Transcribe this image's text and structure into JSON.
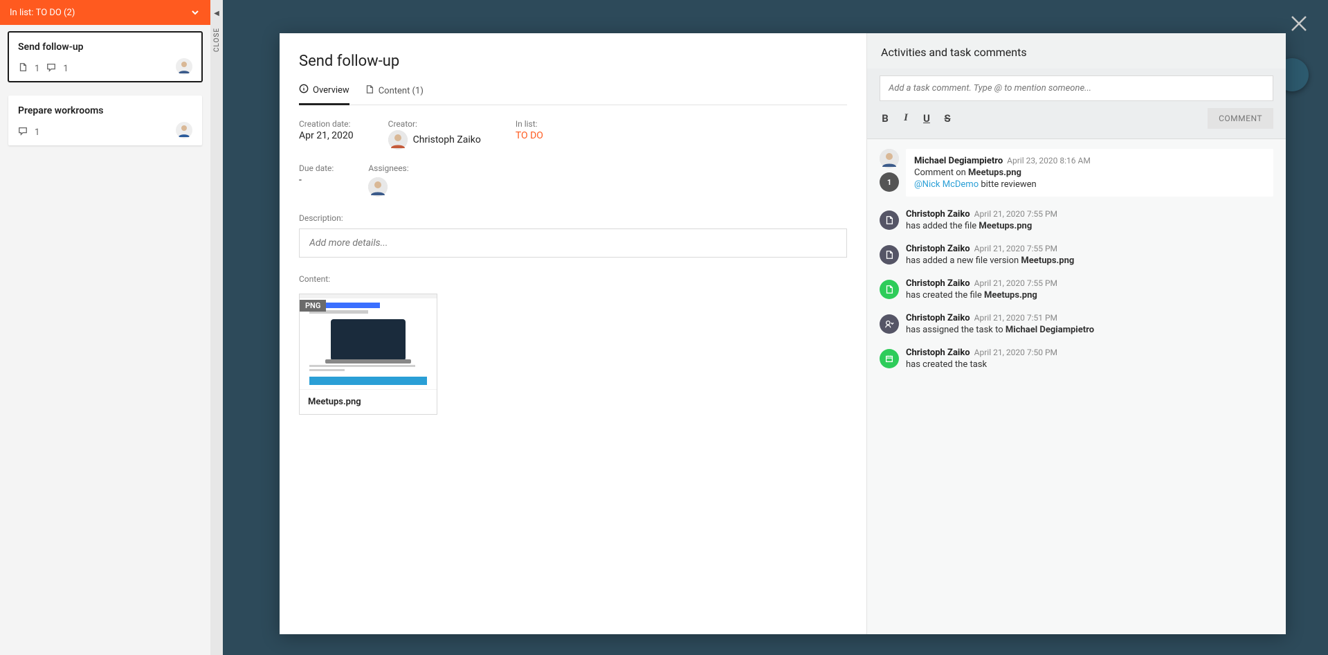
{
  "sidebar": {
    "list_label": "In list:",
    "list_name": "TO DO (2)",
    "close_label": "CLOSE",
    "cards": [
      {
        "title": "Send follow-up",
        "files": "1",
        "comments": "1",
        "active": true
      },
      {
        "title": "Prepare workrooms",
        "files": "",
        "comments": "1",
        "active": false
      }
    ]
  },
  "task": {
    "title": "Send follow-up",
    "tabs": {
      "overview": "Overview",
      "content": "Content (1)"
    },
    "labels": {
      "creation_date": "Creation date:",
      "creator": "Creator:",
      "in_list": "In list:",
      "due_date": "Due date:",
      "assignees": "Assignees:",
      "description": "Description:",
      "content": "Content:"
    },
    "creation_date": "Apr 21, 2020",
    "creator": "Christoph Zaiko",
    "in_list": "TO DO",
    "due_date": "-",
    "description_placeholder": "Add more details...",
    "content_file": {
      "badge": "PNG",
      "name": "Meetups.png"
    }
  },
  "activity": {
    "title": "Activities and task comments",
    "comment_placeholder": "Add a task comment. Type @ to mention someone...",
    "comment_button": "COMMENT",
    "items": [
      {
        "type": "comment",
        "author": "Michael Degiampietro",
        "time": "April 23, 2020 8:16 AM",
        "prefix": "Comment on ",
        "target": "Meetups.png",
        "mention": "@Nick McDemo",
        "mention_suffix": " bitte reviewen",
        "badge": "1"
      },
      {
        "type": "file-grey",
        "author": "Christoph Zaiko",
        "time": "April 21, 2020 7:55 PM",
        "prefix": "has added the file ",
        "target": "Meetups.png"
      },
      {
        "type": "file-grey",
        "author": "Christoph Zaiko",
        "time": "April 21, 2020 7:55 PM",
        "prefix": "has added a new file version ",
        "target": "Meetups.png"
      },
      {
        "type": "file-green",
        "author": "Christoph Zaiko",
        "time": "April 21, 2020 7:55 PM",
        "prefix": "has created the file ",
        "target": "Meetups.png"
      },
      {
        "type": "assign",
        "author": "Christoph Zaiko",
        "time": "April 21, 2020 7:51 PM",
        "prefix": "has assigned the task to ",
        "target": "Michael Degiampietro"
      },
      {
        "type": "created",
        "author": "Christoph Zaiko",
        "time": "April 21, 2020 7:50 PM",
        "prefix": "has created the task",
        "target": ""
      }
    ]
  }
}
